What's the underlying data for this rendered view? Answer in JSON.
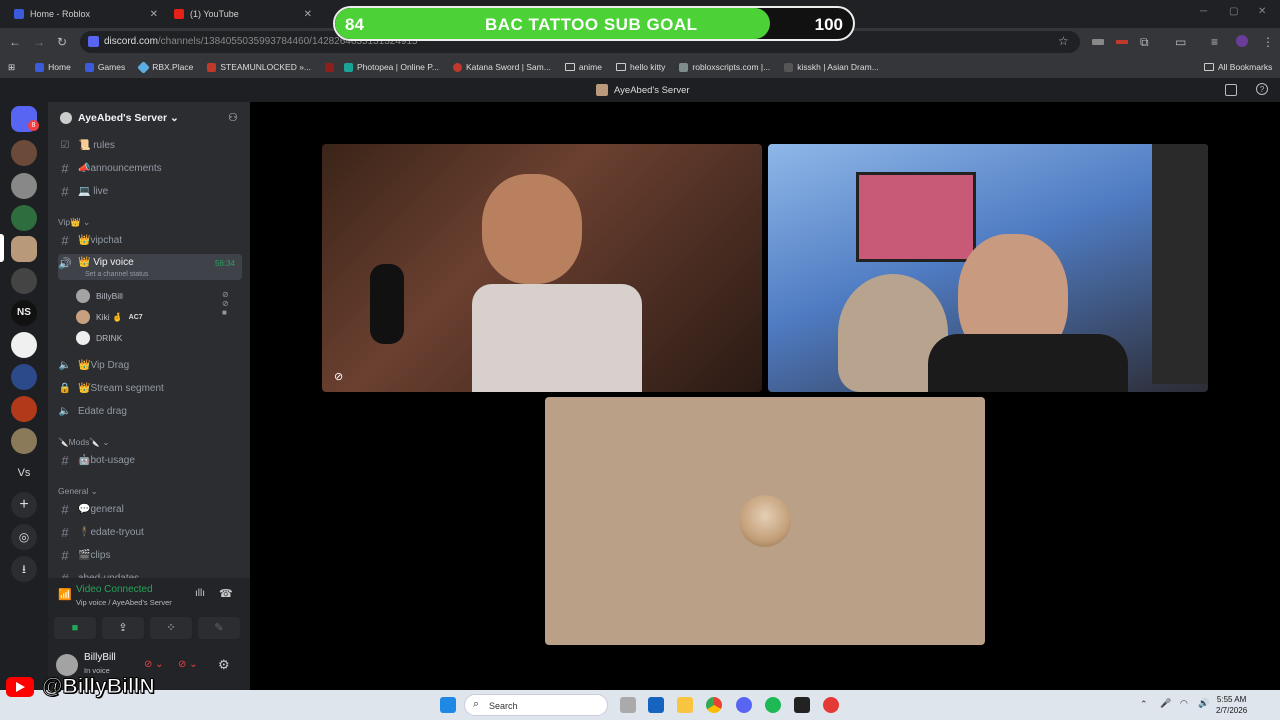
{
  "browser": {
    "tabs": [
      {
        "label": "Home - Roblox",
        "icon": "roblox-icon"
      },
      {
        "label": "(1) YouTube",
        "icon": "youtube-icon"
      }
    ],
    "url": "discord.com",
    "url_path": "/channels/1384055035993784460/1428264635131324915",
    "bookmarks": [
      "Home",
      "Games",
      "RBX.Place",
      "STEAMUNLOCKED »...",
      "Photopea | Online P...",
      "Katana Sword | Sam...",
      "anime",
      "hello kitty",
      "robloxscripts.com |...",
      "kisskh | Asian Dram..."
    ],
    "all_bookmarks": "All Bookmarks"
  },
  "goal": {
    "current": "84",
    "title": "BAC TATTOO SUB GOAL",
    "target": "100",
    "progress": 0.84,
    "color": "#4cd137"
  },
  "discord": {
    "window_title": "AyeAbed's Server",
    "server_name": "AyeAbed's Server",
    "rail_badge": "8",
    "channels_top": [
      {
        "name": "📜 rules",
        "icon": "rules-icon"
      },
      {
        "name": "📣announcements",
        "icon": "hash-icon"
      },
      {
        "name": "💻 live",
        "icon": "hash-icon"
      }
    ],
    "cat_vip": "Vip👑",
    "vipchat": "👑vipchat",
    "vip_voice": "👑 Vip voice",
    "vip_voice_status": "Set a channel status",
    "vip_voice_timer": "56:34",
    "members": [
      {
        "name": "BillyBill"
      },
      {
        "name": "Kiki 🤞",
        "tag": "AC7"
      },
      {
        "name": "DRINK"
      }
    ],
    "vip_drag": "👑Vip Drag",
    "stream_segment": "👑Stream segment",
    "edate_drag": "Edate drag",
    "cat_mods": "🔪Mods🔪",
    "bot_usage": "🤖bot-usage",
    "cat_general": "General",
    "general": "💬general",
    "edate_tryout": "🕴edate-tryout",
    "clips": "🎬clips",
    "cut_channel": "abed-updates",
    "voice_status": "Video Connected",
    "voice_sub": "Vip voice / AyeAbed's Server",
    "user_name": "BillyBill",
    "user_status": "In voice"
  },
  "overlay": {
    "handle": "@BillyBillN"
  },
  "taskbar": {
    "search_placeholder": "Search",
    "time": "5:55 AM",
    "date": "2/7/2026"
  }
}
